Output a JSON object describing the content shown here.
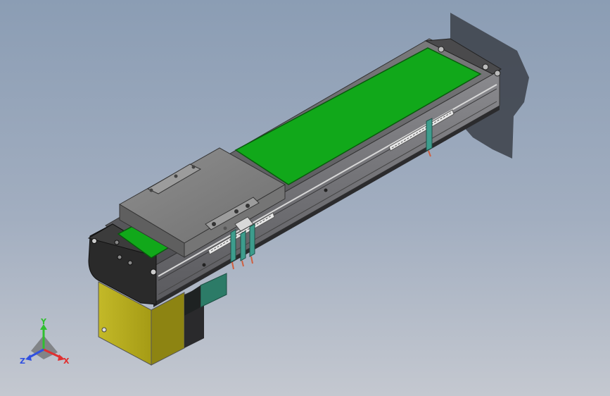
{
  "triad": {
    "x_label": "X",
    "y_label": "Y",
    "z_label": "Z",
    "x_color": "#e03030",
    "y_color": "#30c030",
    "z_color": "#3050e0"
  },
  "model": {
    "belt_color": "#11a81a",
    "motor_color": "#b7ad1c",
    "motor_block_color": "#2c7b67",
    "sensor_color": "#3d9d8d",
    "rail_color": "#6c6c70",
    "carriage_color": "#8c8c8c"
  }
}
